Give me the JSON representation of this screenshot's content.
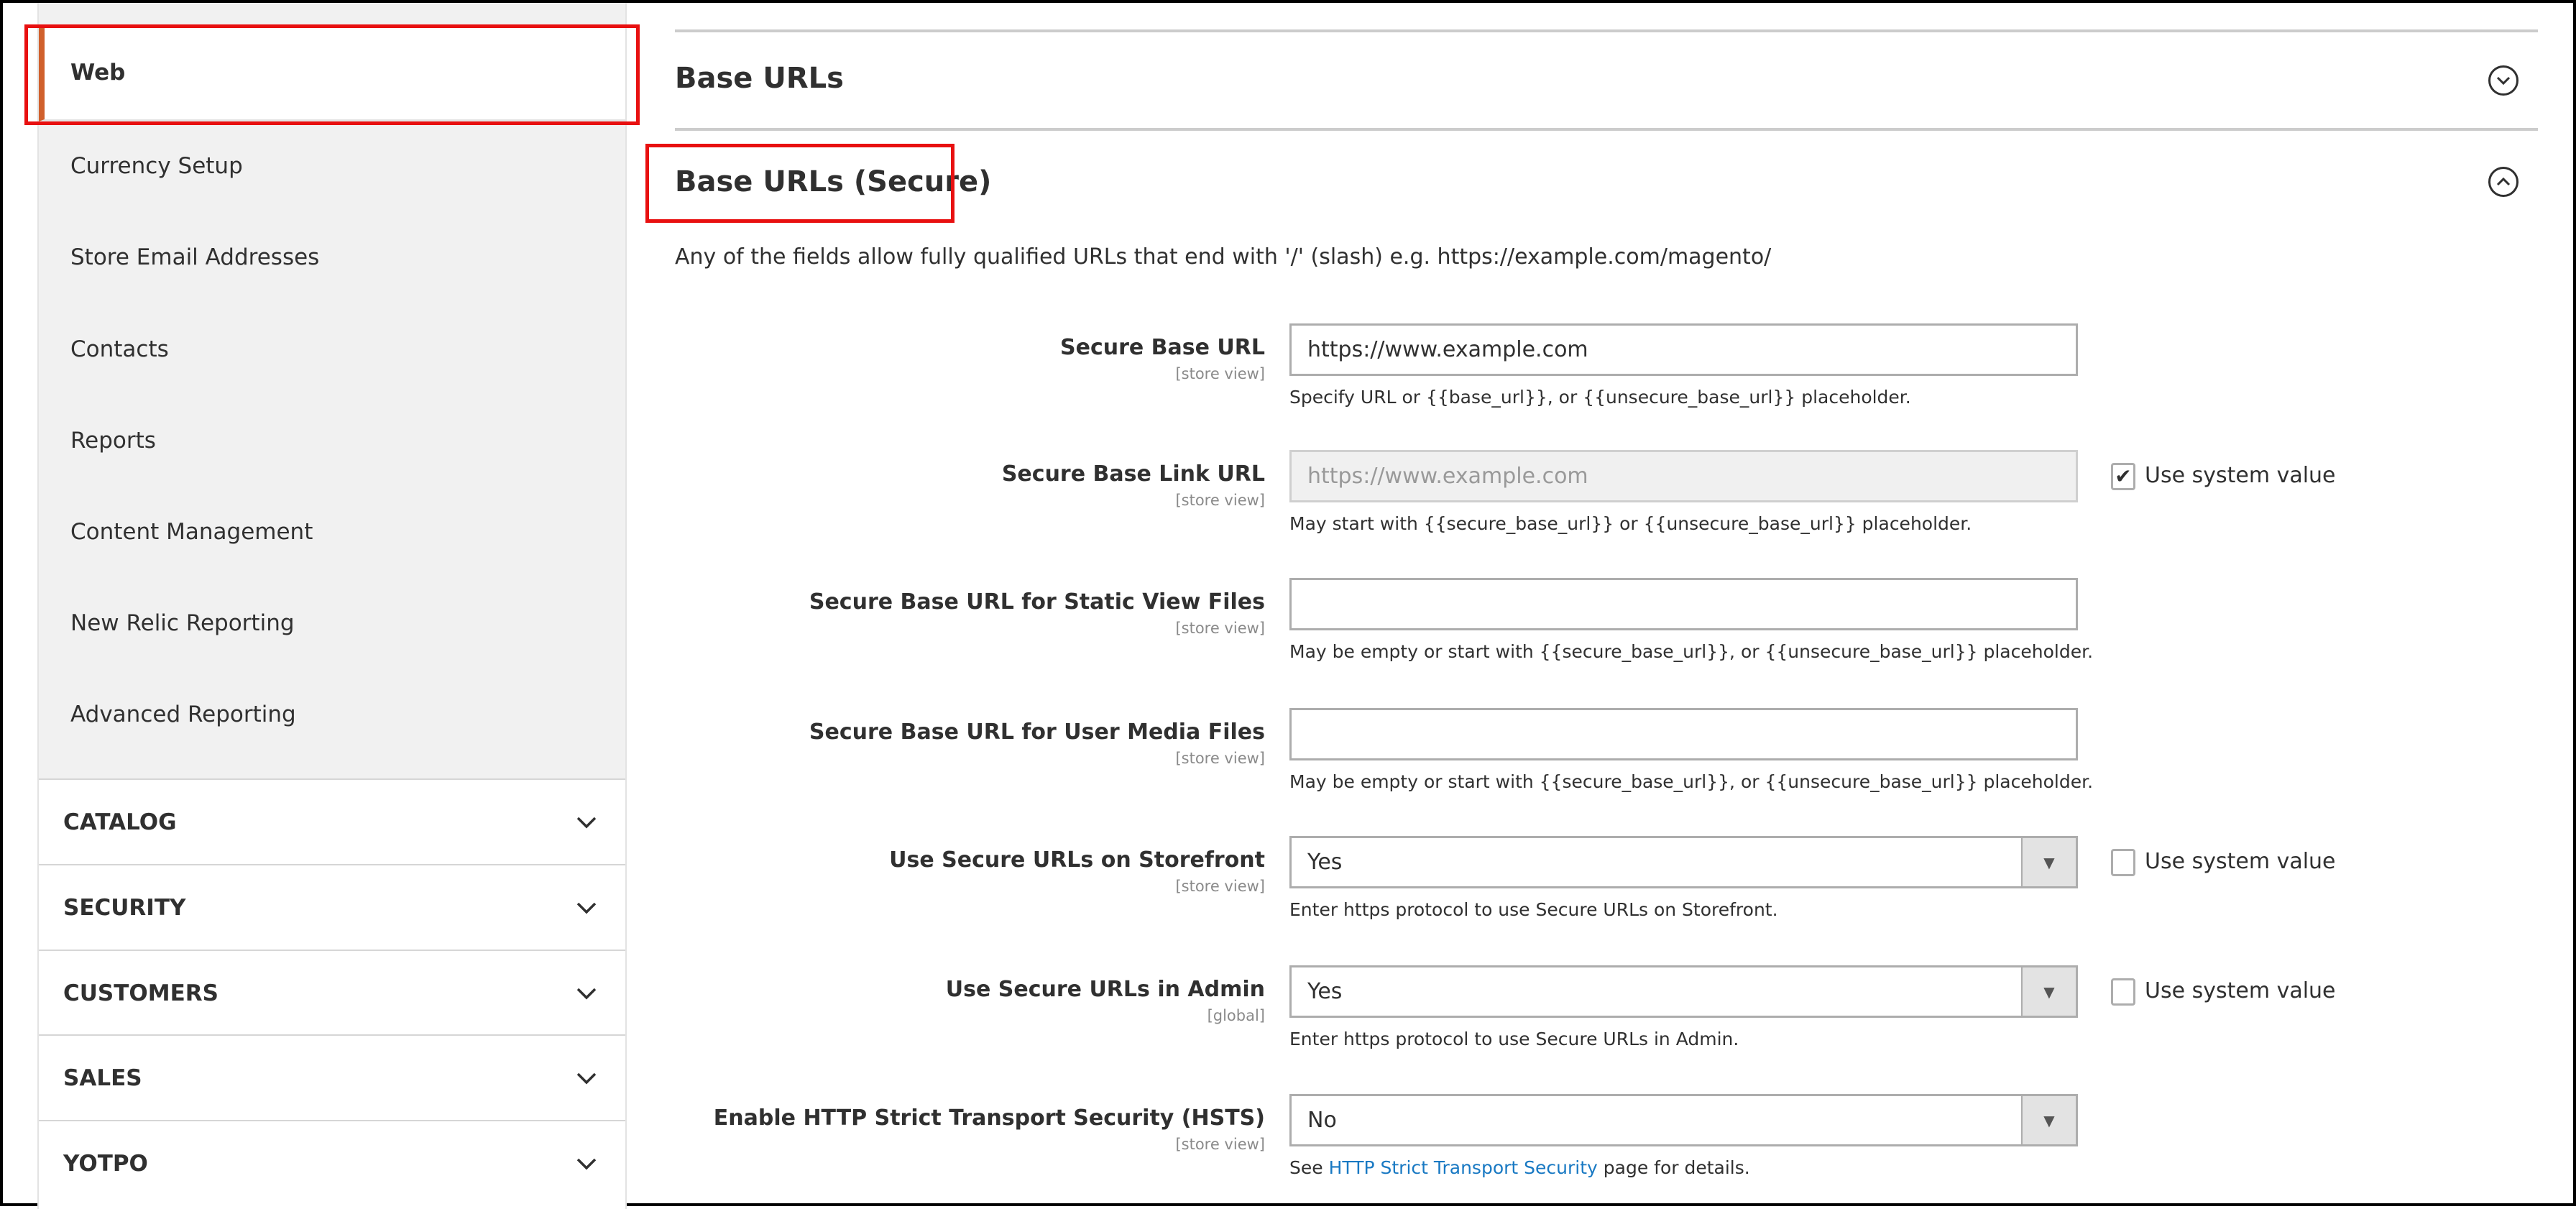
{
  "sidebar": {
    "items": [
      {
        "label": "Web",
        "active": true
      },
      {
        "label": "Currency Setup"
      },
      {
        "label": "Store Email Addresses"
      },
      {
        "label": "Contacts"
      },
      {
        "label": "Reports"
      },
      {
        "label": "Content Management"
      },
      {
        "label": "New Relic Reporting"
      },
      {
        "label": "Advanced Reporting"
      }
    ],
    "sections": [
      {
        "label": "CATALOG"
      },
      {
        "label": "SECURITY"
      },
      {
        "label": "CUSTOMERS"
      },
      {
        "label": "SALES"
      },
      {
        "label": "YOTPO"
      }
    ],
    "active_color": "#d0602c"
  },
  "main": {
    "section1": {
      "title": "Base URLs",
      "icon": "chevron-down-circle-icon"
    },
    "section2": {
      "title": "Base URLs (Secure)",
      "icon": "chevron-up-circle-icon"
    },
    "description": "Any of the fields allow fully qualified URLs that end with '/' (slash) e.g. https://example.com/magento/",
    "fields": [
      {
        "label": "Secure Base URL",
        "scope": "[store view]",
        "value": "https://www.example.com",
        "hint": "Specify URL or {{base_url}}, or {{unsecure_base_url}} placeholder."
      },
      {
        "label": "Secure Base Link URL",
        "scope": "[store view]",
        "value": "https://www.example.com",
        "hint": "May start with {{secure_base_url}} or {{unsecure_base_url}} placeholder.",
        "use_system": "Use system value",
        "checked": true
      },
      {
        "label": "Secure Base URL for Static View Files",
        "scope": "[store view]",
        "value": "",
        "hint": "May be empty or start with {{secure_base_url}}, or {{unsecure_base_url}} placeholder."
      },
      {
        "label": "Secure Base URL for User Media Files",
        "scope": "[store view]",
        "value": "",
        "hint": "May be empty or start with {{secure_base_url}}, or {{unsecure_base_url}} placeholder."
      },
      {
        "label": "Use Secure URLs on Storefront",
        "scope": "[store view]",
        "value": "Yes",
        "hint": "Enter https protocol to use Secure URLs on Storefront.",
        "use_system": "Use system value",
        "checked": false
      },
      {
        "label": "Use Secure URLs in Admin",
        "scope": "[global]",
        "value": "Yes",
        "hint": "Enter https protocol to use Secure URLs in Admin.",
        "use_system": "Use system value",
        "checked": false
      },
      {
        "label": "Enable HTTP Strict Transport Security (HSTS)",
        "scope": "[store view]",
        "value": "No",
        "hint_pre": "See ",
        "hint_link": "HTTP Strict Transport Security",
        "hint_post": " page for details."
      }
    ],
    "link_color": "#1979c3",
    "highlight_color": "#e81010"
  }
}
